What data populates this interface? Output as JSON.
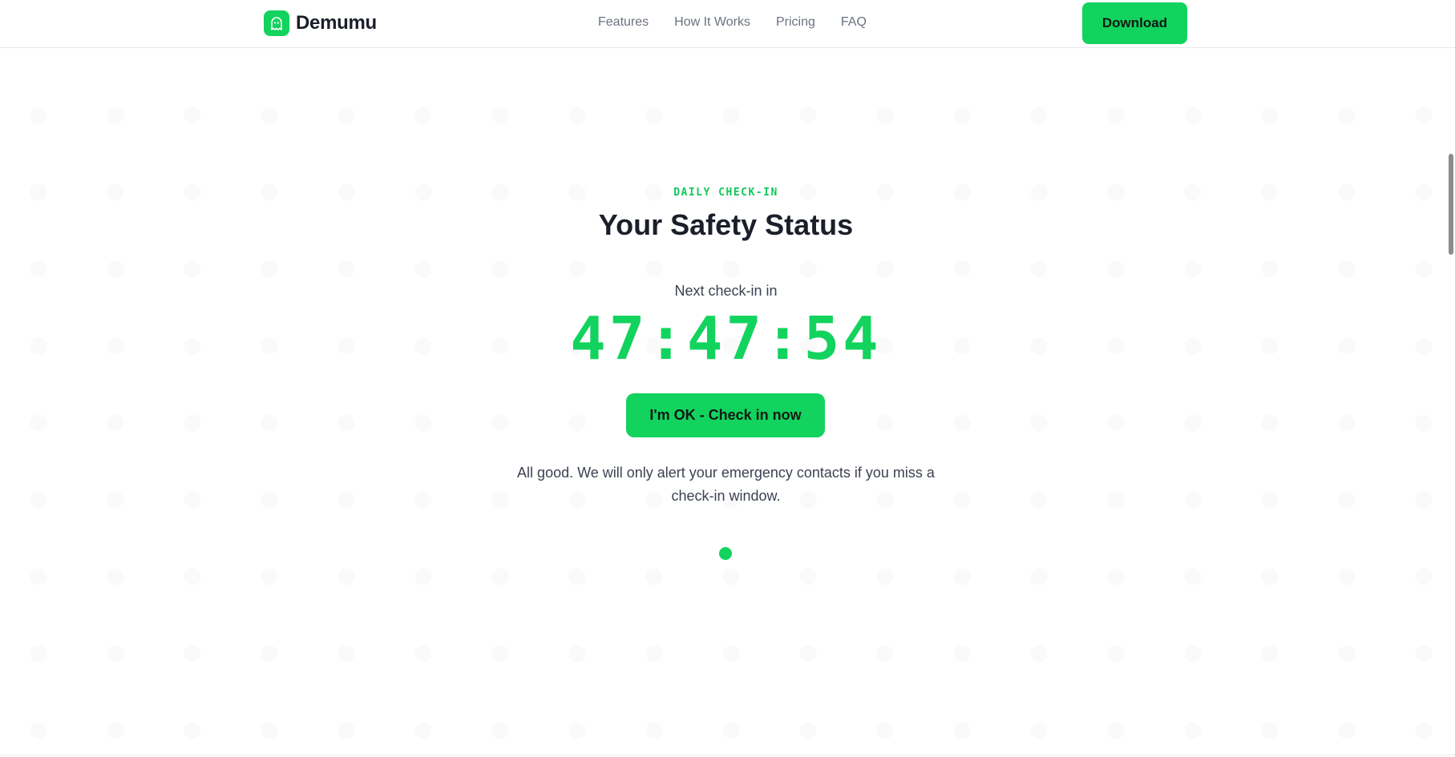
{
  "header": {
    "brand_name": "Demumu",
    "nav": [
      "Features",
      "How It Works",
      "Pricing",
      "FAQ"
    ],
    "download_label": "Download"
  },
  "main": {
    "eyebrow": "DAILY CHECK-IN",
    "title": "Your Safety Status",
    "subtitle": "Next check-in in",
    "countdown": "47:47:54",
    "checkin_label": "I'm OK - Check in now",
    "status_text": "All good. We will only alert your emergency contacts if you miss a check-in window."
  },
  "colors": {
    "accent": "#12d35e",
    "text_dark": "#1b1f2a",
    "text_muted": "#6a7280"
  },
  "icons": {
    "brand_logo": "ghost-icon",
    "status_indicator": "status-dot"
  }
}
